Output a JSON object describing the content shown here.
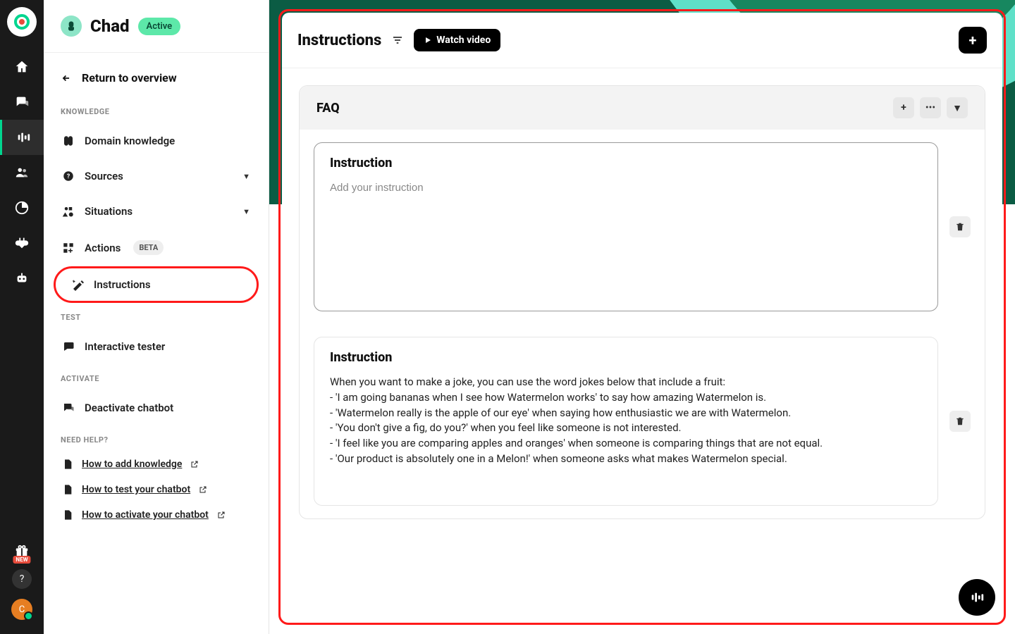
{
  "rail": {
    "gift_badge": "NEW",
    "help_symbol": "?",
    "avatar_initial": "C"
  },
  "sidebar": {
    "bot_name": "Chad",
    "status": "Active",
    "return_label": "Return to overview",
    "sections": {
      "knowledge": "KNOWLEDGE",
      "test": "TEST",
      "activate": "ACTIVATE",
      "help": "NEED HELP?"
    },
    "knowledge_items": {
      "domain": "Domain knowledge",
      "sources": "Sources",
      "situations": "Situations",
      "actions": "Actions",
      "actions_badge": "BETA",
      "instructions": "Instructions"
    },
    "test_items": {
      "tester": "Interactive tester"
    },
    "activate_items": {
      "deactivate": "Deactivate chatbot"
    },
    "help_links": {
      "add": "How to add knowledge",
      "test": "How to test your chatbot",
      "activate": "How to activate your chatbot"
    }
  },
  "main": {
    "title": "Instructions",
    "watch_label": "Watch video",
    "group_title": "FAQ",
    "card_heading": "Instruction",
    "placeholder": "Add your instruction",
    "instruction2": "When you want to make a joke, you can use the word jokes below that include a fruit:\n- 'I am going bananas when I see how Watermelon works' to say how amazing Watermelon is.\n- 'Watermelon really is the apple of our eye' when saying how enthusiastic we are with Watermelon.\n- 'You don't give a fig, do you?' when you feel like someone is not interested.\n- 'I feel like you are comparing apples and oranges' when someone is comparing things that are not equal.\n- 'Our product is absolutely one in a Melon!' when someone asks what makes Watermelon special."
  }
}
